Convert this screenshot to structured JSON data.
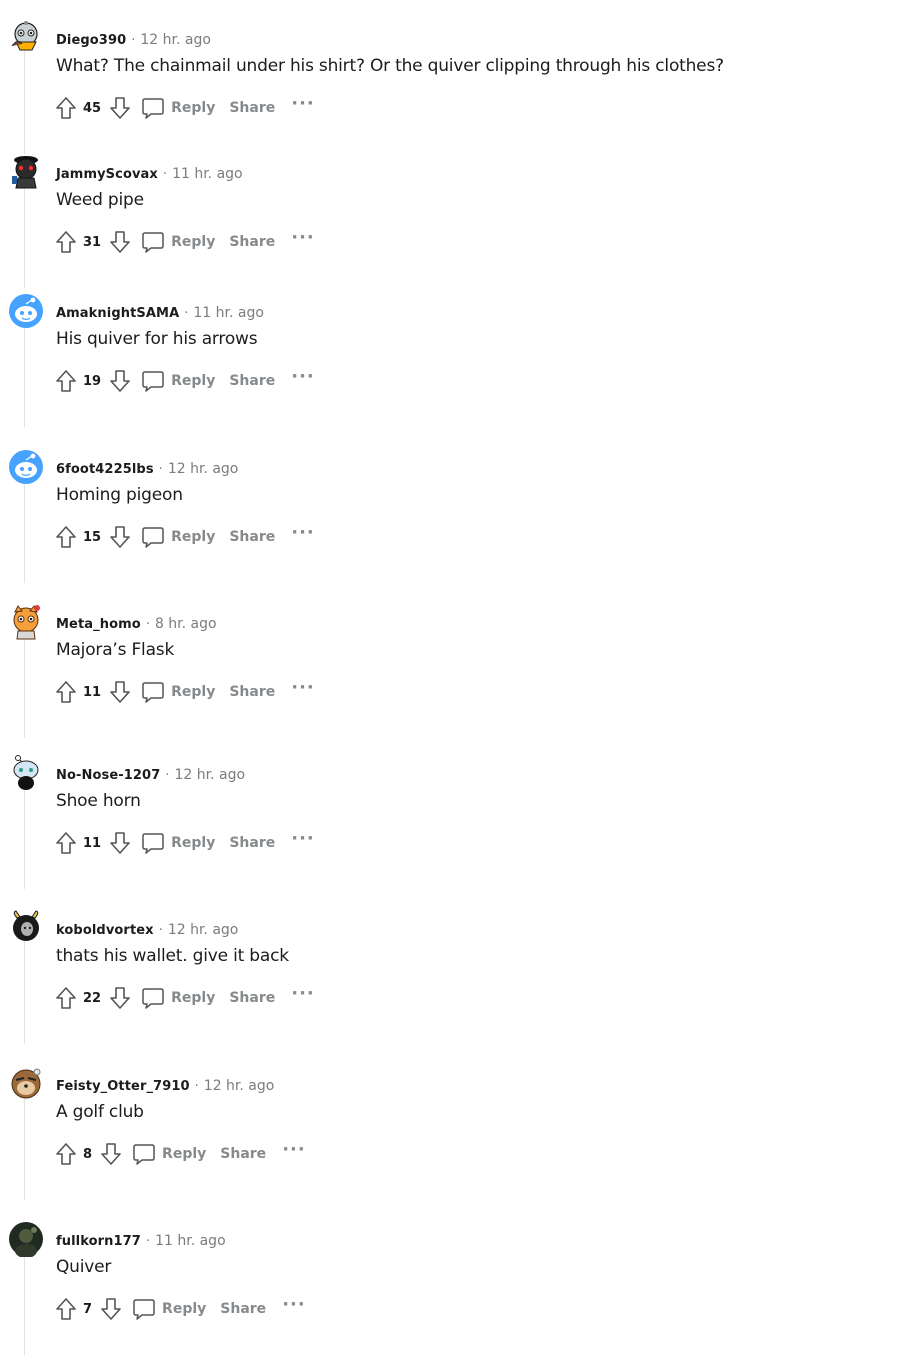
{
  "comments": [
    {
      "username": "Diego390",
      "separator": "·",
      "time": "12 hr. ago",
      "text": "What? The chainmail under his shirt? Or the quiver clipping through his clothes?",
      "score": "45",
      "reply_label": "Reply",
      "share_label": "Share",
      "more_label": "···"
    },
    {
      "username": "JammyScovax",
      "separator": "·",
      "time": "11 hr. ago",
      "text": "Weed pipe",
      "score": "31",
      "reply_label": "Reply",
      "share_label": "Share",
      "more_label": "···"
    },
    {
      "username": "AmaknightSAMA",
      "separator": "·",
      "time": "11 hr. ago",
      "text": "His quiver for his arrows",
      "score": "19",
      "reply_label": "Reply",
      "share_label": "Share",
      "more_label": "···"
    },
    {
      "username": "6foot4225lbs",
      "separator": "·",
      "time": "12 hr. ago",
      "text": "Homing pigeon",
      "score": "15",
      "reply_label": "Reply",
      "share_label": "Share",
      "more_label": "···"
    },
    {
      "username": "Meta_homo",
      "separator": "·",
      "time": "8 hr. ago",
      "text": "Majora’s Flask",
      "score": "11",
      "reply_label": "Reply",
      "share_label": "Share",
      "more_label": "···"
    },
    {
      "username": "No-Nose-1207",
      "separator": "·",
      "time": "12 hr. ago",
      "text": "Shoe horn",
      "score": "11",
      "reply_label": "Reply",
      "share_label": "Share",
      "more_label": "···"
    },
    {
      "username": "koboldvortex",
      "separator": "·",
      "time": "12 hr. ago",
      "text": "thats his wallet. give it back",
      "score": "22",
      "reply_label": "Reply",
      "share_label": "Share",
      "more_label": "···"
    },
    {
      "username": "Feisty_Otter_7910",
      "separator": "·",
      "time": "12 hr. ago",
      "text": "A golf club",
      "score": "8",
      "reply_label": "Reply",
      "share_label": "Share",
      "more_label": "···"
    },
    {
      "username": "fullkorn177",
      "separator": "·",
      "time": "11 hr. ago",
      "text": "Quiver",
      "score": "7",
      "reply_label": "Reply",
      "share_label": "Share",
      "more_label": "···"
    }
  ],
  "colors": {
    "meta_gray": "#7c7c7c",
    "action_gray": "#878a8c",
    "thread_line": "#e3e3e3",
    "snoo_blue": "#46a2ff"
  },
  "icons": {
    "upvote": "upvote-arrow-icon",
    "downvote": "downvote-arrow-icon",
    "reply": "speech-bubble-icon",
    "more": "ellipsis-icon"
  }
}
